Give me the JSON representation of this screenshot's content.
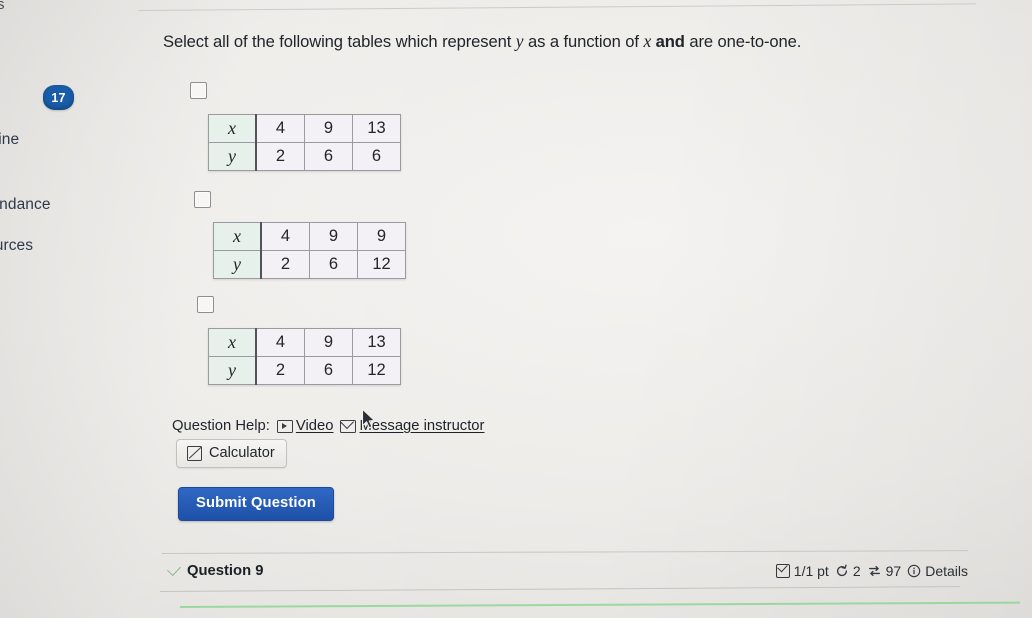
{
  "sidebar": {
    "top_fragment": "s",
    "badge": "17",
    "items": [
      {
        "label": "nline"
      },
      {
        "label": "tendance"
      },
      {
        "label": "ources"
      }
    ]
  },
  "question": {
    "prompt_part1": "Select all of the following tables which represent ",
    "prompt_var_y": "y",
    "prompt_part2": " as a function of ",
    "prompt_var_x": "x",
    "prompt_part3": " ",
    "prompt_bold": "and",
    "prompt_part4": " are one-to-one.",
    "options": [
      {
        "checked": false,
        "row_labels": [
          "x",
          "y"
        ],
        "x_values": [
          "4",
          "9",
          "13"
        ],
        "y_values": [
          "2",
          "6",
          "6"
        ]
      },
      {
        "checked": false,
        "row_labels": [
          "x",
          "y"
        ],
        "x_values": [
          "4",
          "9",
          "9"
        ],
        "y_values": [
          "2",
          "6",
          "12"
        ]
      },
      {
        "checked": false,
        "row_labels": [
          "x",
          "y"
        ],
        "x_values": [
          "4",
          "9",
          "13"
        ],
        "y_values": [
          "2",
          "6",
          "12"
        ]
      }
    ]
  },
  "help": {
    "label": "Question Help:",
    "video_label": "Video",
    "message_label": "Message instructor",
    "calculator_label": "Calculator"
  },
  "actions": {
    "submit_label": "Submit Question"
  },
  "status_bar": {
    "question_label": "Question 9",
    "points": "1/1 pt",
    "attempts": "2",
    "exchanges": "97",
    "details_label": "Details"
  },
  "colors": {
    "accent_blue": "#1e50a8",
    "badge_blue": "#1a5ca8",
    "header_cell": "#e6f1ec",
    "data_cell": "#f3f0f6",
    "green_rule": "#8ed694"
  }
}
